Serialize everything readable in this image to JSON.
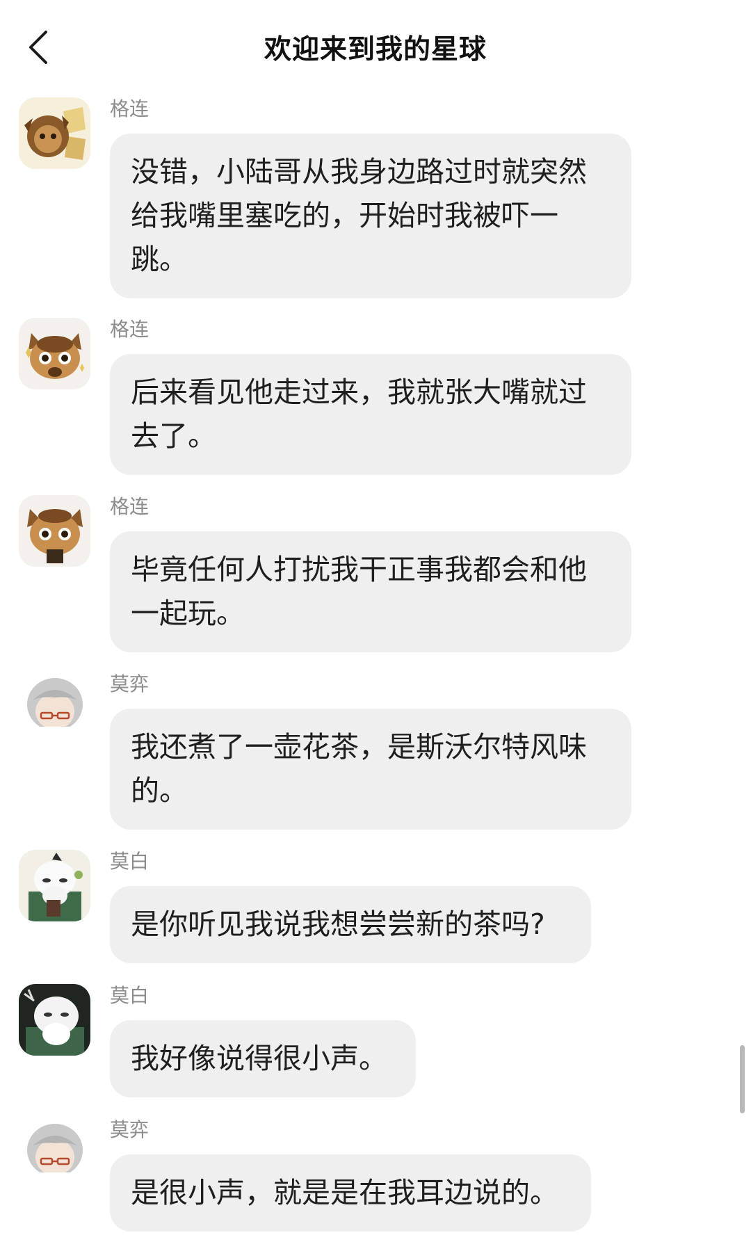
{
  "header": {
    "title": "欢迎来到我的星球",
    "back_icon": "chevron-left-icon"
  },
  "messages": [
    {
      "sender": "格连",
      "avatar": "fox-cub-avatar-gold",
      "text": "没错，小陆哥从我身边路过时就突然给我嘴里塞吃的，开始时我被吓一跳。"
    },
    {
      "sender": "格连",
      "avatar": "fox-cub-avatar",
      "text": "后来看见他走过来，我就张大嘴就过去了。"
    },
    {
      "sender": "格连",
      "avatar": "fox-cub-avatar",
      "text": "毕竟任何人打扰我干正事我都会和他一起玩。"
    },
    {
      "sender": "莫弈",
      "avatar": "white-haired-glasses-avatar",
      "text": "我还煮了一壶花茶，是斯沃尔特风味的。"
    },
    {
      "sender": "莫白",
      "avatar": "white-fluffy-green-coat-avatar",
      "text": "是你听见我说我想尝尝新的茶吗?"
    },
    {
      "sender": "莫白",
      "avatar": "white-fluffy-dark-bg-avatar",
      "text": "我好像说得很小声。"
    },
    {
      "sender": "莫弈",
      "avatar": "white-haired-glasses-avatar",
      "text": "是很小声，就是是在我耳边说的。"
    }
  ],
  "colors": {
    "bubble_bg": "#efefef",
    "sender_text": "#8c8c8c",
    "message_text": "#1f1f1f",
    "title_text": "#111111"
  }
}
